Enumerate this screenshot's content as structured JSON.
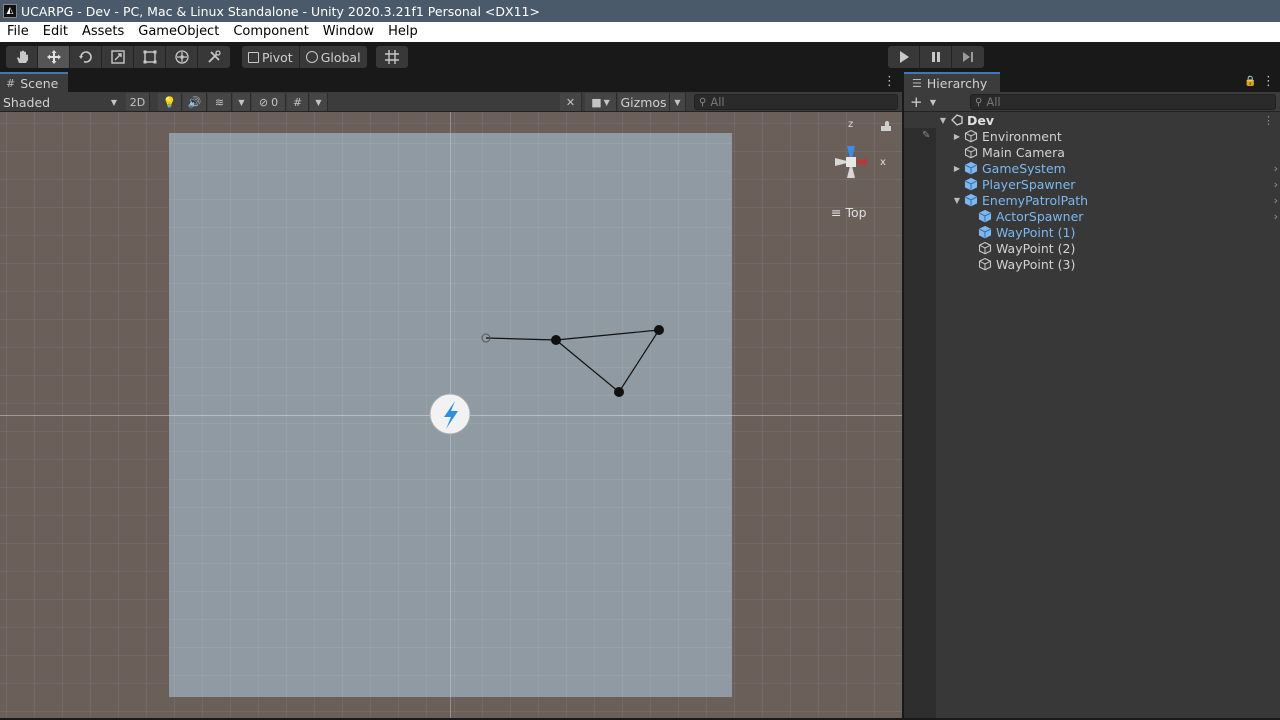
{
  "window": {
    "title": "UCARPG - Dev - PC, Mac & Linux Standalone - Unity 2020.3.21f1 Personal <DX11>"
  },
  "menu": [
    "File",
    "Edit",
    "Assets",
    "GameObject",
    "Component",
    "Window",
    "Help"
  ],
  "toolbar": {
    "tools": [
      "hand-tool",
      "move-tool",
      "rotate-tool",
      "scale-tool",
      "rect-tool",
      "transform-tool",
      "custom-tool"
    ],
    "active_tool": "move-tool",
    "pivot_label": "Pivot",
    "global_label": "Global",
    "play_controls": [
      "play",
      "pause",
      "step"
    ]
  },
  "scene": {
    "tab_label": "Scene",
    "shading_mode": "Shaded",
    "mode_2d_label": "2D",
    "hidden_count": "0",
    "gizmos_label": "Gizmos",
    "search_placeholder": "All",
    "view_label": "Top",
    "gizmo_axes": {
      "z": "z",
      "x": "x"
    }
  },
  "hierarchy": {
    "tab_label": "Hierarchy",
    "search_placeholder": "All",
    "scene_name": "Dev",
    "items": [
      {
        "label": "Environment",
        "depth": 1,
        "expandable": true,
        "expanded": false,
        "prefab": false,
        "has_more": false
      },
      {
        "label": "Main Camera",
        "depth": 1,
        "expandable": false,
        "expanded": false,
        "prefab": false,
        "has_more": false
      },
      {
        "label": "GameSystem",
        "depth": 1,
        "expandable": true,
        "expanded": false,
        "prefab": true,
        "has_more": true
      },
      {
        "label": "PlayerSpawner",
        "depth": 1,
        "expandable": false,
        "expanded": false,
        "prefab": true,
        "has_more": true
      },
      {
        "label": "EnemyPatrolPath",
        "depth": 1,
        "expandable": true,
        "expanded": true,
        "prefab": true,
        "has_more": true
      },
      {
        "label": "ActorSpawner",
        "depth": 2,
        "expandable": false,
        "expanded": false,
        "prefab": true,
        "has_more": true
      },
      {
        "label": "WayPoint (1)",
        "depth": 2,
        "expandable": false,
        "expanded": false,
        "prefab": true,
        "has_more": false
      },
      {
        "label": "WayPoint (2)",
        "depth": 2,
        "expandable": false,
        "expanded": false,
        "prefab": false,
        "has_more": false
      },
      {
        "label": "WayPoint (3)",
        "depth": 2,
        "expandable": false,
        "expanded": false,
        "prefab": false,
        "has_more": false
      }
    ]
  },
  "colors": {
    "prefab_text": "#7cb8f0",
    "accent_tab": "#3a79bb",
    "scene_bg": "#6b5f5a",
    "canvas": "#8f9aa2"
  }
}
